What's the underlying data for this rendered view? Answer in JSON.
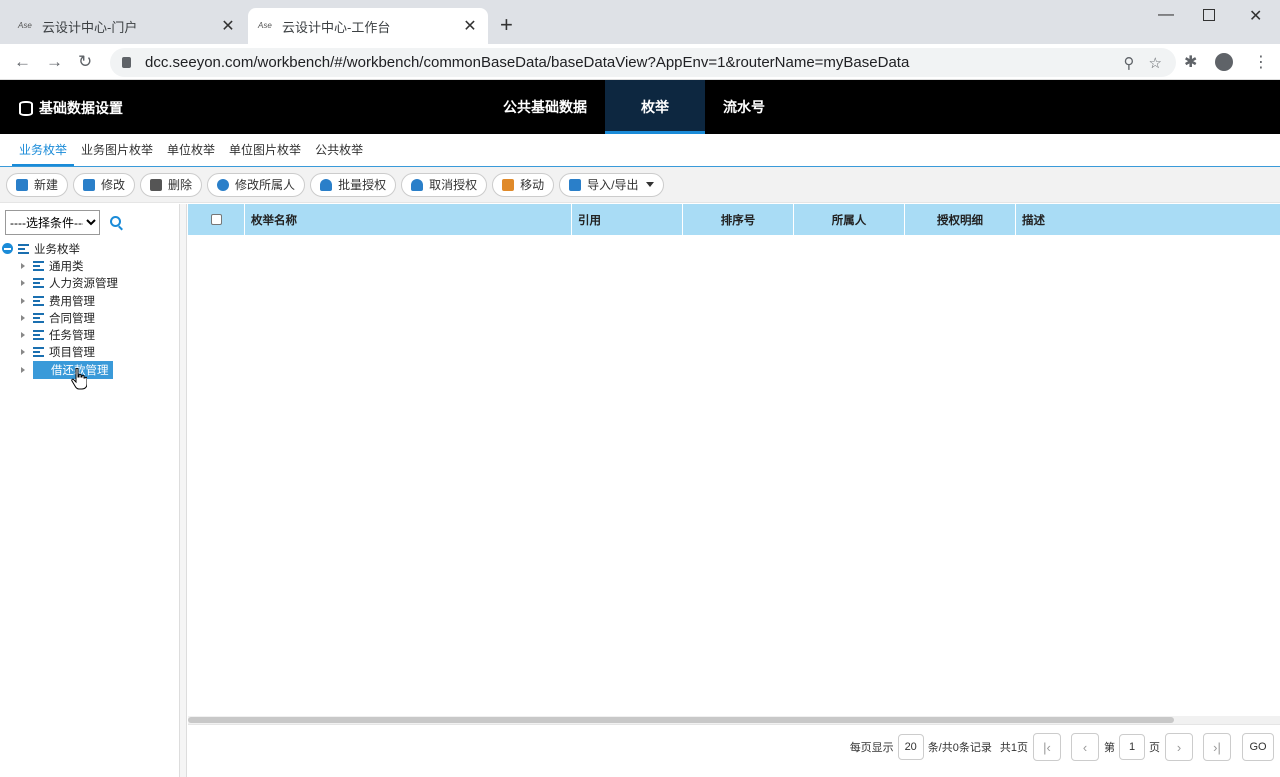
{
  "browser": {
    "tabs": [
      {
        "title": "云设计中心-门户",
        "favicon": "seeyon-logo-icon"
      },
      {
        "title": "云设计中心-工作台",
        "favicon": "seeyon-logo-icon"
      }
    ],
    "url": "dcc.seeyon.com/workbench/#/workbench/commonBaseData/baseDataView?AppEnv=1&routerName=myBaseData"
  },
  "app": {
    "title": "基础数据设置",
    "nav": [
      {
        "label": "公共基础数据"
      },
      {
        "label": "枚举",
        "active": true
      },
      {
        "label": "流水号"
      }
    ]
  },
  "subtabs": [
    {
      "label": "业务枚举",
      "active": true
    },
    {
      "label": "业务图片枚举"
    },
    {
      "label": "单位枚举"
    },
    {
      "label": "单位图片枚举"
    },
    {
      "label": "公共枚举"
    }
  ],
  "toolbar": [
    {
      "label": "新建",
      "icon": "new-doc-icon",
      "color": "#2a7fc9"
    },
    {
      "label": "修改",
      "icon": "edit-icon",
      "color": "#2a7fc9"
    },
    {
      "label": "删除",
      "icon": "trash-icon",
      "color": "#555555"
    },
    {
      "label": "修改所属人",
      "icon": "user-edit-icon",
      "color": "#2a7fc9"
    },
    {
      "label": "批量授权",
      "icon": "authorize-icon",
      "color": "#2a7fc9"
    },
    {
      "label": "取消授权",
      "icon": "revoke-icon",
      "color": "#2a7fc9"
    },
    {
      "label": "移动",
      "icon": "move-arrow-icon",
      "color": "#e08a2a"
    },
    {
      "label": "导入/导出",
      "icon": "import-export-icon",
      "color": "#2a7fc9"
    }
  ],
  "filter": {
    "selected": "----选择条件----"
  },
  "tree": {
    "root": "业务枚举",
    "children": [
      "通用类",
      "人力资源管理",
      "费用管理",
      "合同管理",
      "任务管理",
      "项目管理",
      "借还款管理"
    ],
    "selected_index": 6
  },
  "grid": {
    "columns": [
      "枚举名称",
      "引用",
      "排序号",
      "所属人",
      "授权明细",
      "描述"
    ]
  },
  "pager": {
    "per_page_label": "每页显示",
    "per_page": "20",
    "records_text": "条/共0条记录",
    "pages_text": "共1页",
    "page_prefix": "第",
    "page": "1",
    "page_suffix": "页",
    "go": "GO"
  },
  "colors": {
    "accent": "#1a8bd8",
    "header_bg": "#000000",
    "grid_header": "#a9dcf5"
  }
}
